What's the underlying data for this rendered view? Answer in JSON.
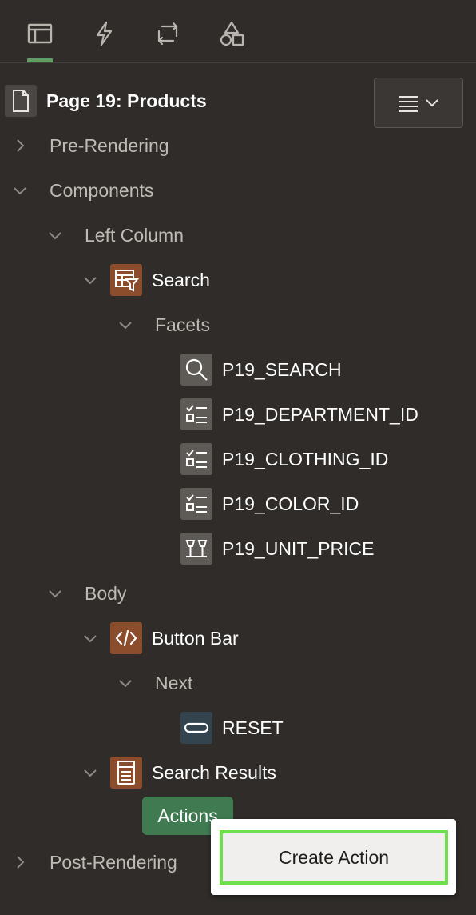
{
  "toolbar": {
    "tabs": [
      {
        "icon": "layout-icon",
        "active": true
      },
      {
        "icon": "lightning-icon",
        "active": false
      },
      {
        "icon": "sync-icon",
        "active": false
      },
      {
        "icon": "shapes-icon",
        "active": false
      }
    ],
    "accent": "#5f9d63"
  },
  "page": {
    "title": "Page 19: Products"
  },
  "menu_button": {
    "icon": "menu-lines-icon",
    "chevron": "chevron-down-icon"
  },
  "tree": {
    "pre_rendering": "Pre-Rendering",
    "components": "Components",
    "left_column": "Left Column",
    "search": "Search",
    "facets": "Facets",
    "facet_items": [
      "P19_SEARCH",
      "P19_DEPARTMENT_ID",
      "P19_CLOTHING_ID",
      "P19_COLOR_ID",
      "P19_UNIT_PRICE"
    ],
    "body": "Body",
    "button_bar": "Button Bar",
    "next": "Next",
    "reset": "RESET",
    "search_results": "Search Results",
    "actions": "Actions",
    "post_rendering": "Post-Rendering"
  },
  "context_menu": {
    "create_action": "Create Action"
  },
  "colors": {
    "background": "#2f2c29",
    "region_icon": "#8b4d2c",
    "item_icon": "#5e5b57",
    "button_icon": "#33444f",
    "actions_chip": "#3f7a51",
    "focus_ring": "#6ee04e"
  }
}
